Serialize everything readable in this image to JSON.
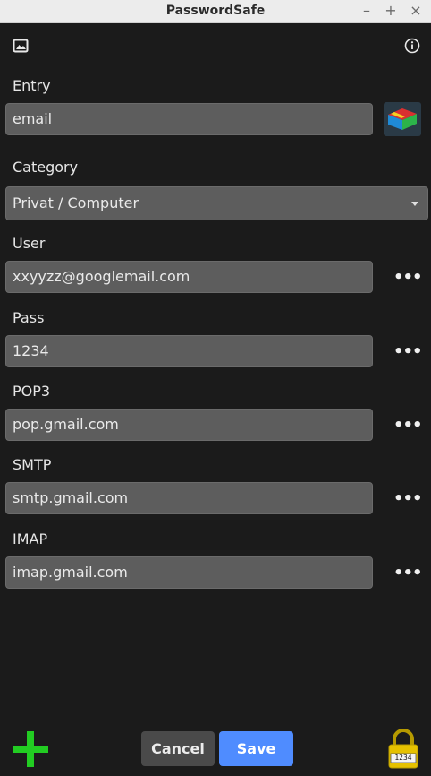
{
  "window": {
    "title": "PasswordSafe"
  },
  "entry": {
    "label": "Entry",
    "value": "email"
  },
  "category": {
    "label": "Category",
    "value": "Privat / Computer"
  },
  "fields": [
    {
      "label": "User",
      "value": "xxyyzz@googlemail.com"
    },
    {
      "label": "Pass",
      "value": "1234"
    },
    {
      "label": "POP3",
      "value": "pop.gmail.com"
    },
    {
      "label": "SMTP",
      "value": "smtp.gmail.com"
    },
    {
      "label": "IMAP",
      "value": "imap.gmail.com"
    }
  ],
  "more_glyph": "•••",
  "buttons": {
    "cancel": "Cancel",
    "save": "Save"
  },
  "lock": {
    "code": "1234"
  },
  "colors": {
    "background": "#1b1b1b",
    "field": "#5d5d5d",
    "save": "#4f8cff",
    "add": "#22cc22",
    "lock": "#e5c100"
  }
}
